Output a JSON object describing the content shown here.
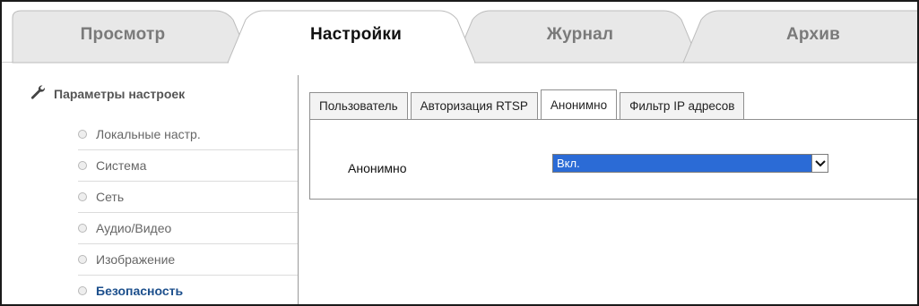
{
  "top_tabs": [
    {
      "label": "Просмотр",
      "active": false
    },
    {
      "label": "Настройки",
      "active": true
    },
    {
      "label": "Журнал",
      "active": false
    },
    {
      "label": "Архив",
      "active": false
    }
  ],
  "sidebar": {
    "header": {
      "label": "Параметры настроек",
      "icon": "wrench-icon"
    },
    "items": [
      {
        "label": "Локальные настр.",
        "active": false
      },
      {
        "label": "Система",
        "active": false
      },
      {
        "label": "Сеть",
        "active": false
      },
      {
        "label": "Аудио/Видео",
        "active": false
      },
      {
        "label": "Изображение",
        "active": false
      },
      {
        "label": "Безопасность",
        "active": true
      }
    ]
  },
  "sub_tabs": [
    {
      "label": "Пользователь",
      "active": false
    },
    {
      "label": "Авторизация RTSP",
      "active": false
    },
    {
      "label": "Анонимно",
      "active": true
    },
    {
      "label": "Фильтр IP адресов",
      "active": false
    }
  ],
  "form": {
    "anonymous_label": "Анонимно",
    "anonymous_value": "Вкл."
  },
  "colors": {
    "active_sidebar_text": "#1c4f8c",
    "select_highlight": "#2b6bd6",
    "inactive_tab_fill": "#e6e6e6"
  }
}
